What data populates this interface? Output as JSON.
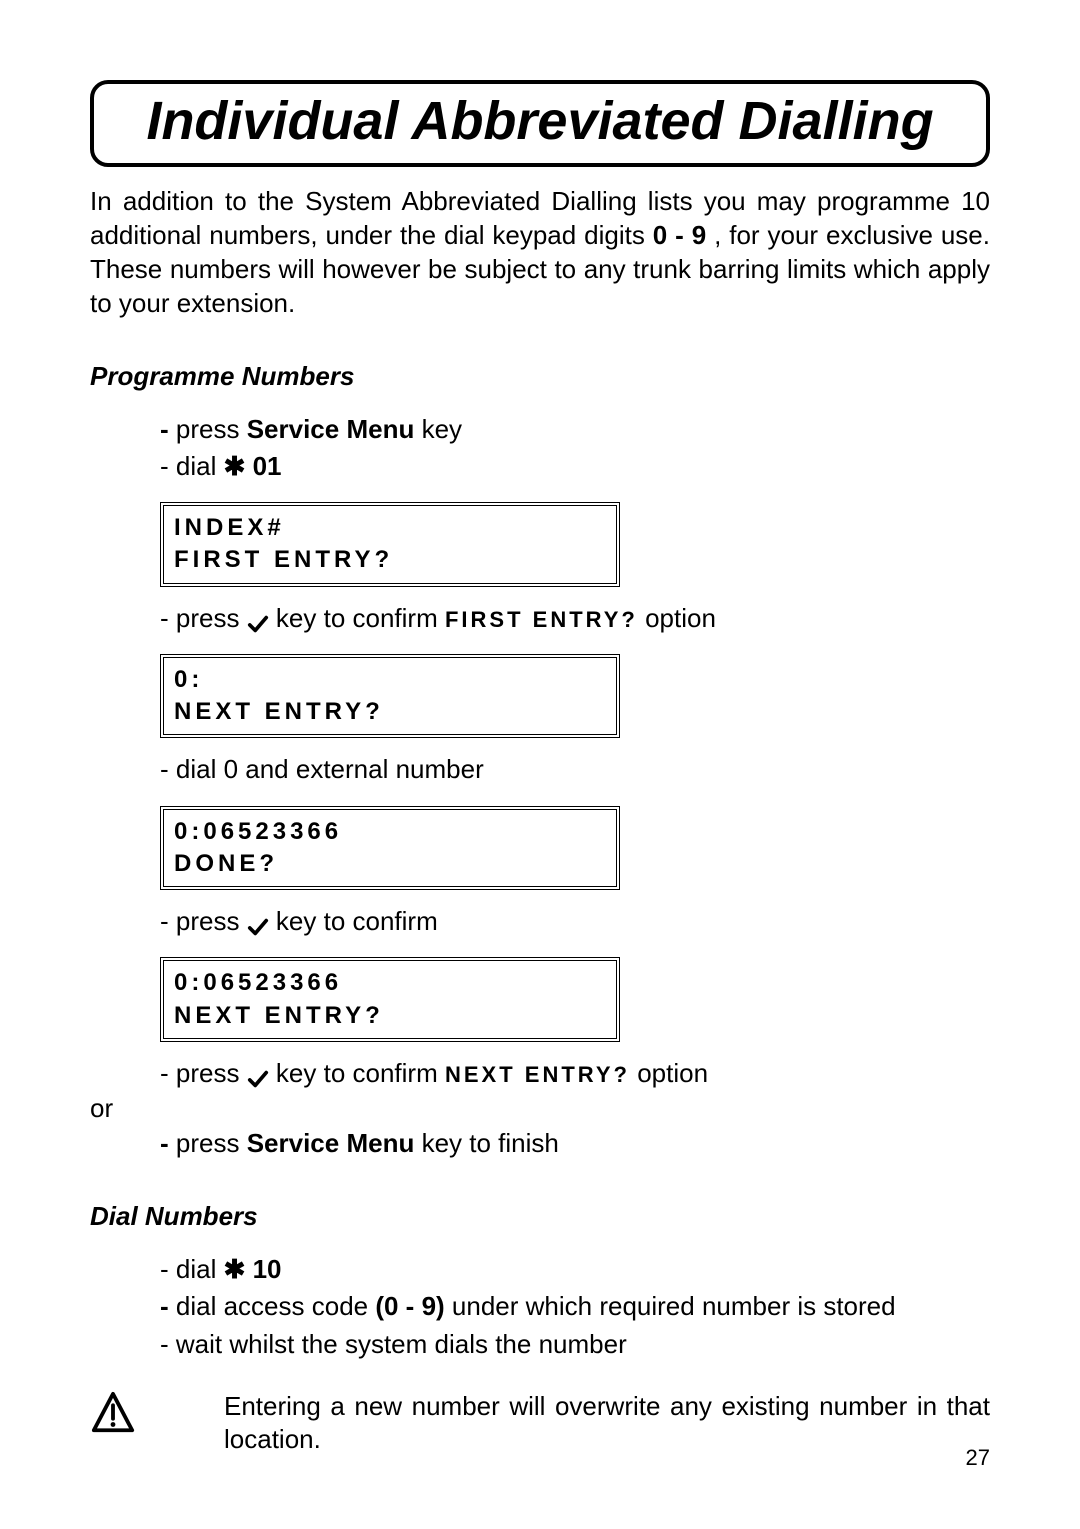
{
  "title": "Individual Abbreviated Dialling",
  "intro": {
    "part1": "In addition to the System Abbreviated Dialling lists you may programme 10 additional numbers, under the dial keypad digits ",
    "bold1": "0 - 9",
    "part2": " , for your exclusive use. These numbers will however be subject to any trunk barring limits which apply to your extension."
  },
  "section1": {
    "title": "Programme Numbers",
    "step1_prefix": "- ",
    "step1a": "press  ",
    "step1_key": "Service Menu",
    "step1b": "  key",
    "step2_prefix": "- dial ",
    "step2_star": "✱",
    "step2_code": " 01",
    "lcd1": {
      "line1": "INDEX#",
      "line2": "FIRST ENTRY?"
    },
    "step3a": "- press  ",
    "step3b": "  key to confirm  ",
    "step3_lcd": "FIRST  ENTRY?",
    "step3c": " option",
    "lcd2": {
      "line1": "0:",
      "line2": "NEXT ENTRY?"
    },
    "step4": "- dial 0 and external number",
    "lcd3": {
      "line1": "0:06523366",
      "line2": "DONE?"
    },
    "step5a": "- press  ",
    "step5b": "  key to confirm",
    "lcd4": {
      "line1": "0:06523366",
      "line2": "NEXT ENTRY?"
    },
    "step6a": "- press  ",
    "step6b": "  key to confirm  ",
    "step6_lcd": "NEXT  ENTRY?",
    "step6c": " option",
    "or": "or",
    "step7_prefix": "- ",
    "step7a": "press  ",
    "step7_key": "Service Menu",
    "step7b": "  key to finish"
  },
  "section2": {
    "title": "Dial Numbers",
    "step1_prefix": "- dial ",
    "step1_star": "✱",
    "step1_code": " 10",
    "step2_prefix": "- ",
    "step2a": "dial access code ",
    "step2_bold": "(0 - 9)",
    "step2b": " under which required number is stored",
    "step3": "- wait whilst the system dials the number"
  },
  "warning": "Entering a new number will overwrite any existing number in that location.",
  "page_number": "27"
}
